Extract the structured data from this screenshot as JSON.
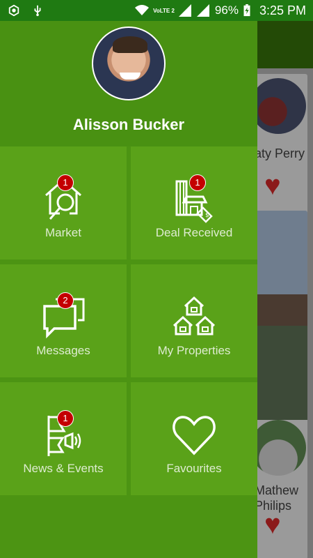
{
  "status_bar": {
    "volte": "VoLTE 2",
    "battery": "96%",
    "time": "3:25 PM"
  },
  "background": {
    "card1_name": "aty Perry",
    "card2_name_line1": "Mathew",
    "card2_name_line2": "Philips"
  },
  "drawer": {
    "user_name": "Alisson Bucker",
    "tiles": [
      {
        "label": "Market",
        "badge": "1"
      },
      {
        "label": "Deal Received",
        "badge": "1"
      },
      {
        "label": "Messages",
        "badge": "2"
      },
      {
        "label": "My Properties"
      },
      {
        "label": "News & Events",
        "badge": "1"
      },
      {
        "label": "Favourites"
      }
    ]
  },
  "colors": {
    "status_bar": "#1f7a12",
    "drawer": "#4c9413",
    "tile": "#5aa219",
    "badge": "#c40000",
    "heart": "#8b1a1a"
  }
}
